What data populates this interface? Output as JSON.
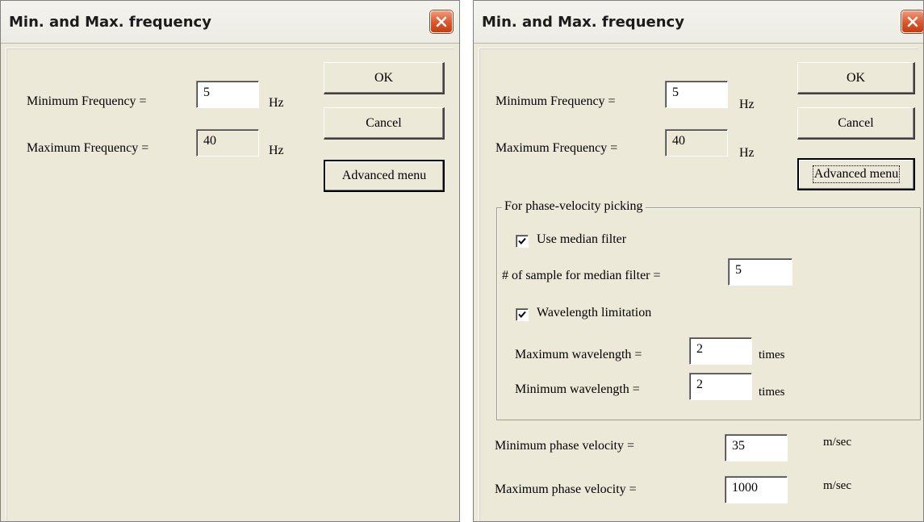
{
  "left_dialog": {
    "title": "Min. and Max. frequency",
    "close_icon": "close-icon",
    "min_freq_label": "Minimum Frequency =",
    "min_freq_value": "5",
    "min_freq_unit": "Hz",
    "max_freq_label": "Maximum Frequency =",
    "max_freq_value": "40",
    "max_freq_unit": "Hz",
    "ok_label": "OK",
    "cancel_label": "Cancel",
    "advanced_label": "Advanced menu"
  },
  "right_dialog": {
    "title": "Min. and Max. frequency",
    "close_icon": "close-icon",
    "min_freq_label": "Minimum Frequency =",
    "min_freq_value": "5",
    "min_freq_unit": "Hz",
    "max_freq_label": "Maximum Frequency =",
    "max_freq_value": "40",
    "max_freq_unit": "Hz",
    "ok_label": "OK",
    "cancel_label": "Cancel",
    "advanced_label": "Advanced menu",
    "group_title": "For phase-velocity picking",
    "use_median_label": "Use median filter",
    "use_median_checked": true,
    "median_samples_label": "# of sample for median filter =",
    "median_samples_value": "5",
    "wavelength_limit_label": "Wavelength limitation",
    "wavelength_limit_checked": true,
    "max_wavelength_label": "Maximum wavelength =",
    "max_wavelength_value": "2",
    "max_wavelength_unit": "times",
    "min_wavelength_label": "Minimum wavelength =",
    "min_wavelength_value": "2",
    "min_wavelength_unit": "times",
    "min_phase_vel_label": "Minimum phase velocity =",
    "min_phase_vel_value": "35",
    "min_phase_vel_unit": "m/sec",
    "max_phase_vel_label": "Maximum phase velocity =",
    "max_phase_vel_value": "1000",
    "max_phase_vel_unit": "m/sec"
  },
  "colors": {
    "dialog_bg": "#ece9d8",
    "close_button": "#d9562a"
  }
}
